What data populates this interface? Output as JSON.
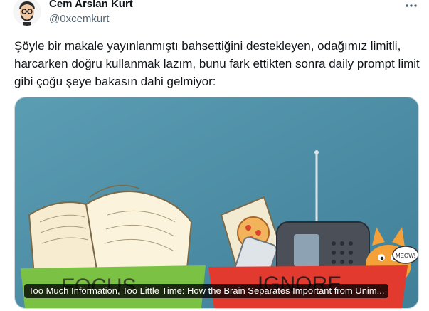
{
  "author": {
    "display_name": "Cem Arslan Kurt",
    "handle": "@0xcemkurt",
    "avatar_icon": "cartoon-avatar-icon"
  },
  "tweet": {
    "text": "Şöyle bir makale yayınlanmıştı bahsettiğini destekleyen, odağımız limitli, harcarken doğru kullanmak lazım, bunu fark ettikten sonra daily prompt limit gibi çoğu şeye bakasın dahi gelmiyor:"
  },
  "card": {
    "title": "Too Much Information, Too Little Time: How the Brain Separates Important from Unim...",
    "illustration": {
      "focus_label": "FOCUS",
      "ignore_label": "IGNORE",
      "cat_sound": "MEOW!",
      "colors": {
        "background": "#4a8ba3",
        "focus_box": "#7bc143",
        "ignore_box": "#e23a2e",
        "book_pages": "#fbf3dc",
        "cat": "#f4a13a"
      }
    }
  },
  "icons": {
    "more": "more-options-icon"
  }
}
